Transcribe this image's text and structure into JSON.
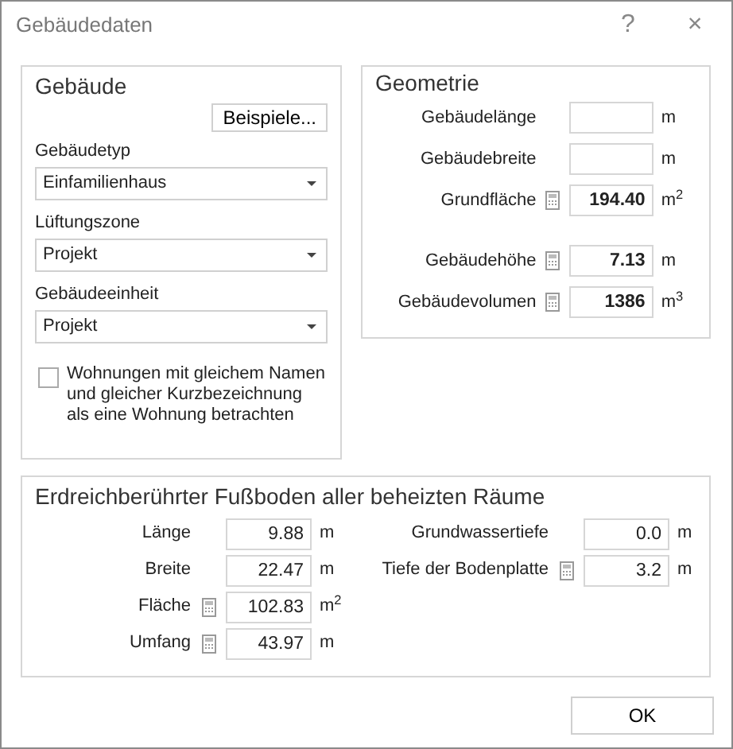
{
  "window": {
    "title": "Gebäudedaten",
    "buttons": [
      "?",
      "×"
    ]
  },
  "gebaeude": {
    "title": "Gebäude",
    "examples_button": "Beispiele...",
    "dropdowns": [
      {
        "label": "Gebäudetyp",
        "value": "Einfamilienhaus"
      },
      {
        "label": "Lüftungszone",
        "value": "Projekt"
      },
      {
        "label": "Gebäudeeinheit",
        "value": "Projekt"
      }
    ],
    "checkbox": {
      "label": "Wohnungen mit gleichem Namen und gleicher Kurzbezeichnung als eine Wohnung betrachten",
      "checked": false
    }
  },
  "geometrie": {
    "title": "Geometrie",
    "groups": [
      [
        {
          "label": "Gebäudelänge",
          "unit": "m",
          "calc": false
        },
        {
          "label": "Gebäudebreite",
          "unit": "m",
          "calc": false
        },
        {
          "label": "Grundfläche",
          "value": "194.40",
          "unit": "m$^{2}$",
          "calc": true
        }
      ],
      [
        {
          "label": "Gebäudehöhe",
          "value": "7.13",
          "unit": "m",
          "calc": true
        },
        {
          "label": "Gebäudevolumen",
          "value": "1386",
          "unit": "m$^{3}$",
          "calc": true
        }
      ]
    ]
  },
  "boden": {
    "title": "Erdreichberührter Fußboden aller beheizten Räume",
    "columns": [
      [
        {
          "label": "Länge",
          "value": "9.88",
          "unit": "m",
          "calc": false
        },
        {
          "label": "Breite",
          "value": "22.47",
          "unit": "m",
          "calc": false
        },
        {
          "label": "Fläche",
          "value": "102.83",
          "unit": "m$^{2}$",
          "calc": true
        },
        {
          "label": "Umfang",
          "value": "43.97",
          "unit": "m",
          "calc": true
        }
      ],
      [
        {
          "label": "Grundwassertiefe",
          "value": "0.0",
          "unit": "m",
          "calc": false
        },
        {
          "label": "Tiefe der Bodenplatte",
          "value": "3.2",
          "unit": "m",
          "calc": true
        }
      ]
    ]
  },
  "ok_button": "OK"
}
